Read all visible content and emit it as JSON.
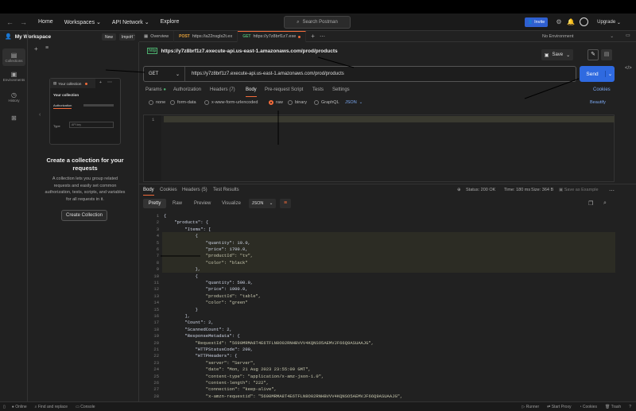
{
  "topbar": {
    "nav": [
      "Home",
      "Workspaces",
      "API Network",
      "Explore"
    ],
    "search_placeholder": "Search Postman",
    "invite": "Invite",
    "upgrade": "Upgrade"
  },
  "rail": [
    {
      "label": "Collections",
      "icon": "collections-icon"
    },
    {
      "label": "Environments",
      "icon": "environments-icon"
    },
    {
      "label": "History",
      "icon": "history-icon"
    },
    {
      "label": "",
      "icon": "apps-icon"
    }
  ],
  "workspace": {
    "name": "My Workspace",
    "new": "New",
    "import": "Import"
  },
  "sidebar": {
    "preview": {
      "title": "Your collection",
      "heading": "Your collection",
      "tab": "Authorization",
      "type_label": "Type",
      "type_value": "API key"
    },
    "title": "Create a collection for your requests",
    "desc": "A collection lets you group related requests and easily set common authorization, tests, scripts, and variables for all requests in it.",
    "button": "Create Collection"
  },
  "tabs": [
    {
      "label": "Overview",
      "method": ""
    },
    {
      "label": "https://a22nsgls2t.ex",
      "method": "POST"
    },
    {
      "label": "https://y7z8brf1z7.exe",
      "method": "GET"
    }
  ],
  "environment": "No Environment",
  "request": {
    "title": "https://y7z8brf1z7.execute-api.us-east-1.amazonaws.com/prod/products",
    "save": "Save",
    "method": "GET",
    "url": "https://y7z8brf1z7.execute-api.us-east-1.amazonaws.com/prod/products",
    "send": "Send",
    "tabs": [
      "Params",
      "Authorization",
      "Headers (7)",
      "Body",
      "Pre-request Script",
      "Tests",
      "Settings"
    ],
    "cookies": "Cookies",
    "body_options": [
      "none",
      "form-data",
      "x-www-form-urlencoded",
      "raw",
      "binary",
      "GraphQL"
    ],
    "body_format": "JSON",
    "beautify": "Beautify",
    "editor_line": "1"
  },
  "response": {
    "tabs": [
      "Body",
      "Cookies",
      "Headers (5)",
      "Test Results"
    ],
    "status": "Status: 200 OK",
    "time": "Time: 180 ms",
    "size": "Size: 364 B",
    "save": "Save as Example",
    "views": [
      "Pretty",
      "Raw",
      "Preview",
      "Visualize"
    ],
    "format": "JSON",
    "lines": [
      {
        "n": "1",
        "t": "{"
      },
      {
        "n": "2",
        "t": "    \"products\": {"
      },
      {
        "n": "3",
        "t": "        \"Items\": ["
      },
      {
        "n": "4",
        "t": "            {"
      },
      {
        "n": "5",
        "t": "                \"quantity\": 10.0,"
      },
      {
        "n": "6",
        "t": "                \"price\": 1700.0,"
      },
      {
        "n": "7",
        "t": "                \"productId\": \"tv\","
      },
      {
        "n": "8",
        "t": "                \"color\": \"black\""
      },
      {
        "n": "9",
        "t": "            },"
      },
      {
        "n": "10",
        "t": "            {"
      },
      {
        "n": "11",
        "t": "                \"quantity\": 500.0,"
      },
      {
        "n": "12",
        "t": "                \"price\": 1000.0,"
      },
      {
        "n": "13",
        "t": "                \"productId\": \"table\","
      },
      {
        "n": "14",
        "t": "                \"color\": \"green\""
      },
      {
        "n": "15",
        "t": "            }"
      },
      {
        "n": "16",
        "t": "        ],"
      },
      {
        "n": "17",
        "t": "        \"Count\": 2,"
      },
      {
        "n": "18",
        "t": "        \"ScannedCount\": 2,"
      },
      {
        "n": "19",
        "t": "        \"ResponseMetadata\": {"
      },
      {
        "n": "20",
        "t": "            \"RequestId\": \"5690MRMA8T4E6TFLN8O02RNHBVVV4KQNSO5AEMVJF66Q9ASUAAJG\","
      },
      {
        "n": "21",
        "t": "            \"HTTPStatusCode\": 200,"
      },
      {
        "n": "22",
        "t": "            \"HTTPHeaders\": {"
      },
      {
        "n": "23",
        "t": "                \"server\": \"Server\","
      },
      {
        "n": "24",
        "t": "                \"date\": \"Mon, 21 Aug 2023 23:55:09 GMT\","
      },
      {
        "n": "25",
        "t": "                \"content-type\": \"application/x-amz-json-1.0\","
      },
      {
        "n": "26",
        "t": "                \"content-length\": \"222\","
      },
      {
        "n": "27",
        "t": "                \"connection\": \"keep-alive\","
      },
      {
        "n": "28",
        "t": "                \"x-amzn-requestid\": \"5690MRMA8T4E6TFLN8O02RNHBVVV4KQNSO5AEMVJF66Q9ASUAAJG\","
      }
    ]
  },
  "statusbar": {
    "left": [
      "Online",
      "Find and replace",
      "Console"
    ],
    "right": [
      "Runner",
      "Start Proxy",
      "Cookies",
      "Trash"
    ]
  },
  "colors": {
    "accent": "#f26b3a",
    "send": "#2f6ae0",
    "bg": "#212121"
  }
}
